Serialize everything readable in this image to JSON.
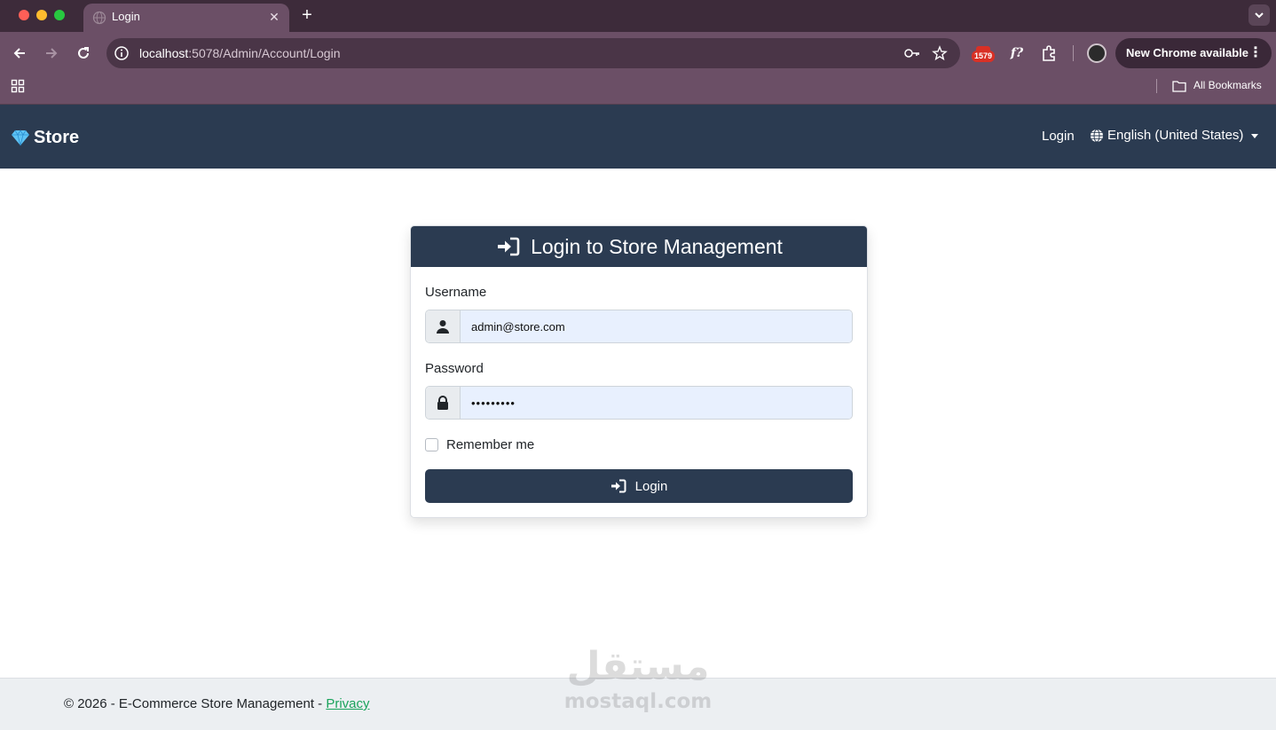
{
  "browser": {
    "tab_title": "Login",
    "url_host": "localhost",
    "url_path": ":5078/Admin/Account/Login",
    "extension_badge": "1579",
    "update_label": "New Chrome available",
    "bookmarks_label": "All Bookmarks"
  },
  "navbar": {
    "brand": "Store",
    "login_link": "Login",
    "language": "English (United States)"
  },
  "login_card": {
    "title": "Login to Store Management",
    "username_label": "Username",
    "username_value": "admin@store.com",
    "password_label": "Password",
    "password_value": "•••••••••",
    "remember_label": "Remember me",
    "submit_label": "Login"
  },
  "footer": {
    "text": "© 2026 - E-Commerce Store Management - ",
    "privacy_link": "Privacy"
  },
  "watermark": {
    "arabic": "مستقل",
    "latin": "mostaql.com"
  },
  "colors": {
    "navbar_bg": "#2b3b51",
    "browser_frame": "#6b4f66",
    "autofill_bg": "#e8f0fe",
    "footer_link": "#1aa35c"
  }
}
